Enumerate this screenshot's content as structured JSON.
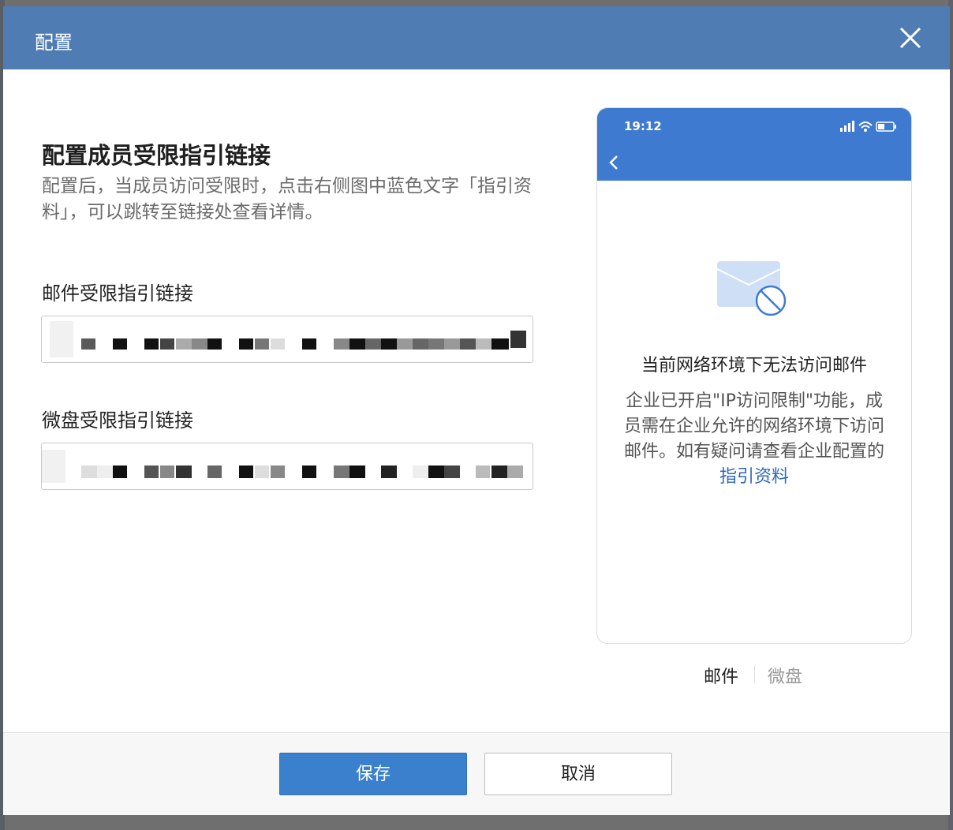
{
  "dialog": {
    "title": "配置",
    "close_icon": "close-icon"
  },
  "main": {
    "section_title": "配置成员受限指引链接",
    "description": "配置后，当成员访问受限时，点击右侧图中蓝色文字「指引资料」，可以跳转至链接处查看详情。",
    "mail_field": {
      "label": "邮件受限指引链接",
      "value_hidden": true
    },
    "disk_field": {
      "label": "微盘受限指引链接",
      "value_hidden": true
    }
  },
  "preview": {
    "time": "19:12",
    "back_icon": "chevron-left-icon",
    "illustration_icon": "mail-blocked-icon",
    "heading": "当前网络环境下无法访问邮件",
    "body_text": "企业已开启\"IP访问限制\"功能，成员需在企业允许的网络环境下访问邮件。如有疑问请查看企业配置的",
    "link_text": "指引资料",
    "tabs": [
      {
        "label": "邮件",
        "active": true
      },
      {
        "label": "微盘",
        "active": false
      }
    ]
  },
  "footer": {
    "save_label": "保存",
    "cancel_label": "取消"
  },
  "colors": {
    "header": "#4f7cb3",
    "phone_top": "#3d7ad0",
    "primary_button": "#3b80cd",
    "link": "#2f67b5"
  }
}
